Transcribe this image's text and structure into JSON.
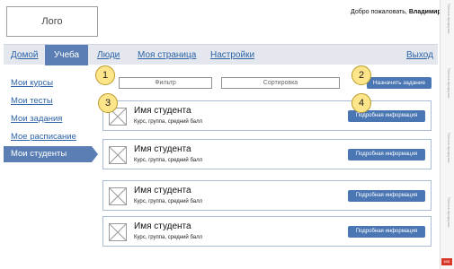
{
  "header": {
    "logo_text": "Лого",
    "welcome_prefix": "Добро пожаловать,",
    "username": "Владимир"
  },
  "nav": {
    "items": [
      "Домой",
      "Учеба",
      "Люди",
      "Моя страница",
      "Настройки"
    ],
    "active_index": 1,
    "logout": "Выход"
  },
  "sidebar": {
    "items": [
      "Мои курсы",
      "Мои тесты",
      "Мои задания",
      "Мое расписание",
      "Мои студенты"
    ],
    "active_index": 4
  },
  "toolbar": {
    "filter_placeholder": "Фильтр",
    "sort_placeholder": "Сортировка",
    "assign_label": "Назначить задание"
  },
  "students": [
    {
      "name": "Имя студента",
      "meta": "Курс, группа, средний балл",
      "button": "Подробная информация"
    },
    {
      "name": "Имя студента",
      "meta": "Курс, группа, средний балл",
      "button": "Подробная информация"
    },
    {
      "name": "Имя студента",
      "meta": "Курс, группа, средний балл",
      "button": "Подробная информация"
    },
    {
      "name": "Имя студента",
      "meta": "Курс, группа, средний балл",
      "button": "Подробная информация"
    }
  ],
  "markers": [
    "1",
    "2",
    "3",
    "4"
  ],
  "right_panel": {
    "labels": [
      "Полоса прокрутки",
      "Полоса прокрутки",
      "Полоса прокрутки",
      "Полоса прокрутки"
    ],
    "page_badge": "608"
  },
  "colors": {
    "accent": "#5b7fb4",
    "button": "#4a76b3",
    "link": "#2d63a7",
    "marker": "#ffe58a"
  }
}
